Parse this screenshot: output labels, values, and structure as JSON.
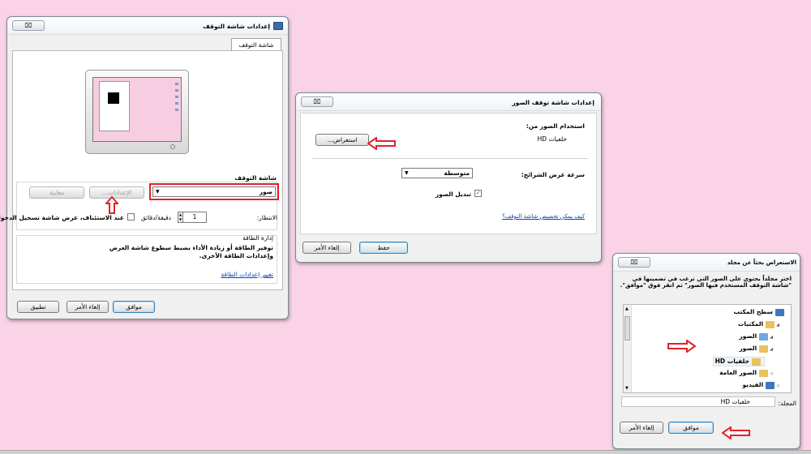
{
  "close_glyph": "⌧",
  "dialog1": {
    "title": "إعدادات شاشة التوقف",
    "tab": "شاشة التوقف",
    "group_label": "شاشة التوقف",
    "screensaver_value": "صور",
    "settings_button": "الإعدادات...",
    "preview_button": "معاينة",
    "wait_label": "الانتظار:",
    "wait_value": "1",
    "minutes_label": "دقيقة/دقائق",
    "resume_label": "عند الاستئناف، عرض شاشة تسجيل الدخول",
    "power_title": "إدارة الطاقة",
    "power_text": "توفير الطاقة أو زيادة الأداء بضبط سطوع شاشة العرض وإعدادات الطاقة الأخرى.",
    "power_link": "تغيير إعدادات الطاقة",
    "ok": "موافق",
    "cancel": "إلغاء الأمر",
    "apply": "تطبيق"
  },
  "dialog2": {
    "title": "إعدادات شاشة توقف الصور",
    "use_pictures_label": "استخدام الصور من:",
    "source_value": "خلفيات HD",
    "browse_button": "استعراض...",
    "speed_label": "سرعة عرض الشرائح:",
    "speed_value": "متوسطة",
    "shuffle_label": "تبديل الصور",
    "help_link": "كيف يمكن تخصيص شاشة التوقف؟",
    "save": "حفظ",
    "cancel": "إلغاء الأمر"
  },
  "dialog3": {
    "title": "الاستعراض بحثاً عن مجلد",
    "instruction": "اختر مجلداً يحتوي على الصور التي ترغب في تضمينها في \"شاشة التوقف المستخدم فيها الصور\" ثم انقر فوق \"موافق\".",
    "tree": [
      {
        "label": "سطح المكتب",
        "icon": "desktop-icon",
        "color": "#3b78c4"
      },
      {
        "label": "المكتبات",
        "icon": "libraries-icon",
        "color": "#e9c25b"
      },
      {
        "label": "الصور",
        "icon": "pictures-library-icon",
        "color": "#6fa8dc"
      },
      {
        "label": "الصور",
        "icon": "pictures-folder-icon",
        "color": "#e9c25b"
      },
      {
        "label": "خلفيات HD",
        "icon": "folder-icon",
        "color": "#e9c25b"
      },
      {
        "label": "الصور العامة",
        "icon": "folder-icon",
        "color": "#e9c25b"
      },
      {
        "label": "الفيديو",
        "icon": "video-library-icon",
        "color": "#3b78c4"
      }
    ],
    "folder_label": "المجلد:",
    "folder_value": "خلفيات HD",
    "ok": "موافق",
    "cancel": "إلغاء الأمر"
  },
  "colors": {
    "background": "#fad4e6",
    "highlight": "#e0222b"
  }
}
